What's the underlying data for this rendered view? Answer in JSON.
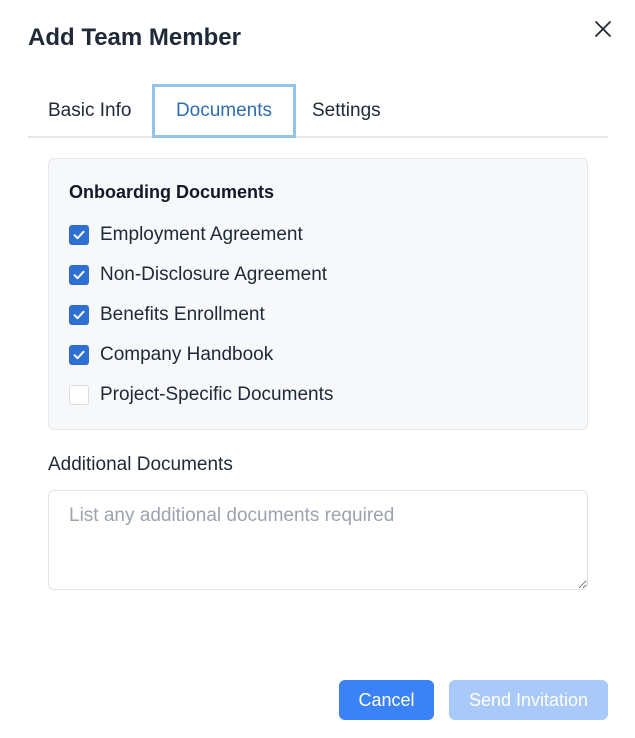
{
  "dialog": {
    "title": "Add Team Member",
    "close_icon": "close-icon"
  },
  "tabs": [
    {
      "label": "Basic Info",
      "active": false
    },
    {
      "label": "Documents",
      "active": true
    },
    {
      "label": "Settings",
      "active": false
    }
  ],
  "onboarding": {
    "title": "Onboarding Documents",
    "items": [
      {
        "label": "Employment Agreement",
        "checked": true
      },
      {
        "label": "Non-Disclosure Agreement",
        "checked": true
      },
      {
        "label": "Benefits Enrollment",
        "checked": true
      },
      {
        "label": "Company Handbook",
        "checked": true
      },
      {
        "label": "Project-Specific Documents",
        "checked": false
      }
    ]
  },
  "additional": {
    "label": "Additional Documents",
    "placeholder": "List any additional documents required",
    "value": ""
  },
  "footer": {
    "cancel_label": "Cancel",
    "send_label": "Send Invitation"
  },
  "colors": {
    "primary": "#3b82f6",
    "primary_disabled": "#a9caf8",
    "checkbox": "#2f6fd1",
    "active_tab_text": "#2f6db3",
    "active_tab_border": "#93c5ec"
  }
}
